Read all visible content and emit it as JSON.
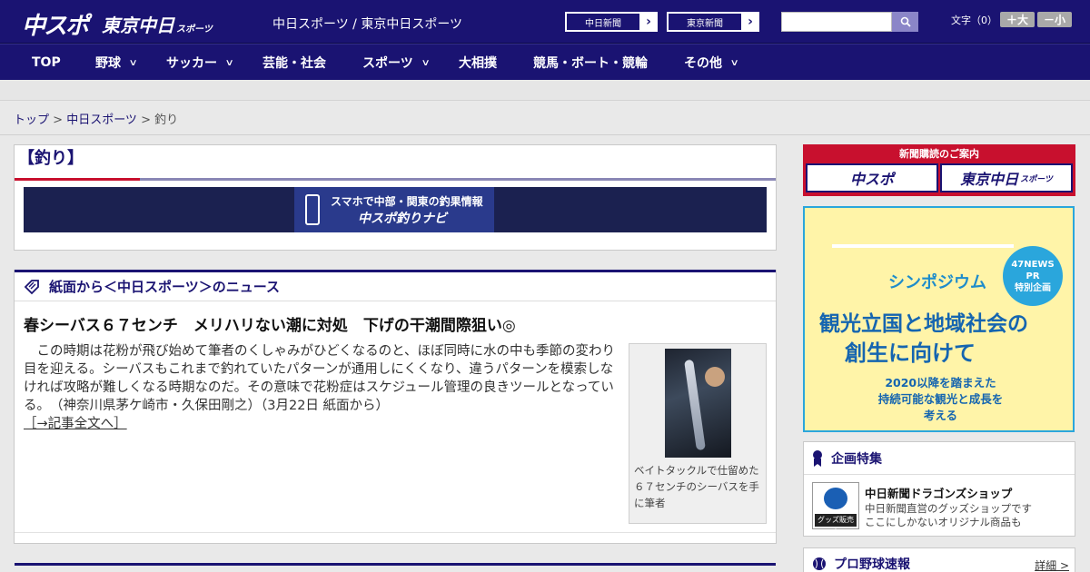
{
  "header": {
    "logo_chuspo": "中スポ",
    "logo_tokyo": "東京中日",
    "logo_tokyo_sub": "スポーツ",
    "site_name": "中日スポーツ / 東京中日スポーツ",
    "link1": "中日新聞",
    "link2": "東京新聞",
    "search_placeholder": "",
    "font_label": "文字（0）",
    "font_bigger": "＋大",
    "font_smaller": "－小"
  },
  "nav": [
    {
      "label": "TOP"
    },
    {
      "label": "野球"
    },
    {
      "label": "サッカー"
    },
    {
      "label": "芸能・社会"
    },
    {
      "label": "スポーツ"
    },
    {
      "label": "大相撲"
    },
    {
      "label": "競馬・ボート・競輪"
    },
    {
      "label": "その他"
    }
  ],
  "breadcrumb": {
    "top": "トップ",
    "sep1": " > ",
    "cat": "中日スポーツ",
    "sep2": " > ",
    "current": "釣り"
  },
  "category_title": "【釣り】",
  "banner": {
    "line1": "スマホで中部・関東の釣果情報",
    "line2": "中スポ釣りナビ"
  },
  "news": {
    "section_title": "紙面から＜中日スポーツ＞のニュース",
    "title": "春シーバス６７センチ　メリハリない潮に対処　下げの干潮間際狙い◎",
    "body": "この時期は花粉が飛び始めて筆者のくしゃみがひどくなるのと、ほぼ同時に水の中も季節の変わり目を迎える。シーバスもこれまで釣れていたパターンが通用しにくくなり、違うパターンを模索しなければ攻略が難しくなる時期なのだ。その意味で花粉症はスケジュール管理の良きツールとなっている。　（神奈川県茅ケ崎市・久保田剛之）（3月22日 紙面から）",
    "more": "［→記事全文へ］",
    "caption": "ベイトタックルで仕留めた６７センチのシーバスを手に筆者"
  },
  "sidebar": {
    "subscribe_title": "新聞購読のご案内",
    "subscribe_btn1": "中スポ",
    "subscribe_btn2": "東京中日",
    "subscribe_btn2_sub": "スポーツ",
    "ad": {
      "symposium": "シンポジウム",
      "badge_l1": "47NEWS",
      "badge_l2": "PR",
      "badge_l3": "特別企画",
      "line1": "観光立国と地域社会の",
      "line2": "創生に向けて",
      "line3": "2020以降を踏まえた",
      "line4": "持続可能な観光と成長を",
      "line5": "考える"
    },
    "feature_title": "企画特集",
    "goods_badge": "グッズ販売中",
    "goods_title": "中日新聞ドラゴンズショップ",
    "goods_desc1": "中日新聞直営のグッズショップです",
    "goods_desc2": "ここにしかないオリジナル商品も",
    "baseball_title": "プロ野球速報",
    "baseball_detail": "詳細 >"
  },
  "colors": {
    "navy": "#1a1372",
    "red": "#c8102e",
    "ad_blue": "#2aa6dc"
  }
}
